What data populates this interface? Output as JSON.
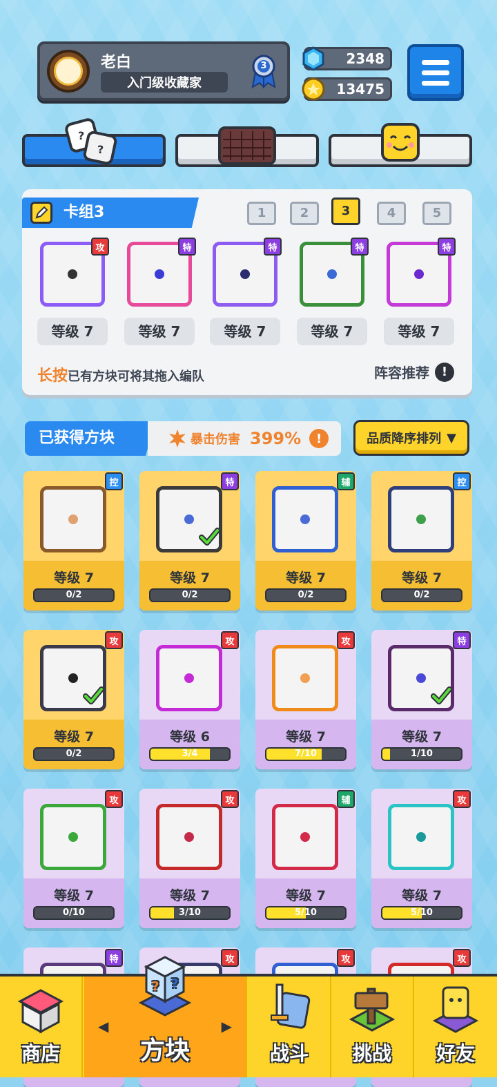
{
  "profile": {
    "name": "老白",
    "title": "入门级收藏家",
    "rank": "3"
  },
  "currency": {
    "gems": "2348",
    "coins": "13475"
  },
  "deck": {
    "title": "卡组3",
    "slots": [
      "1",
      "2",
      "3",
      "4",
      "5"
    ],
    "active_slot": "3",
    "cards": [
      {
        "tag": "攻",
        "tag_type": "atk",
        "level": "等级 7",
        "color": "#8b5cf6",
        "dot": "#333333"
      },
      {
        "tag": "特",
        "tag_type": "spe",
        "level": "等级 7",
        "color": "#e84a9a",
        "dot": "#3b3bd6"
      },
      {
        "tag": "特",
        "tag_type": "spe",
        "level": "等级 7",
        "color": "#8c5cf0",
        "dot": "#2c2c70"
      },
      {
        "tag": "特",
        "tag_type": "spe",
        "level": "等级 7",
        "color": "#3a8f3a",
        "dot": "#3b6ad6"
      },
      {
        "tag": "特",
        "tag_type": "spe",
        "level": "等级 7",
        "color": "#c43ad6",
        "dot": "#6a2ad0"
      }
    ],
    "hint_highlight": "长按",
    "hint_text": "已有方块可将其拖入编队",
    "recommend": "阵容推荐"
  },
  "owned": {
    "title": "已获得方块",
    "crit_label": "暴击伤害",
    "crit_value": "399%",
    "sort_label": "品质降序排列"
  },
  "cards": [
    {
      "tag": "控",
      "tag_type": "ctl",
      "level": "等级 7",
      "progress": "0/2",
      "fill": 0,
      "style": "gold",
      "color": "#8a5a2a",
      "dot": "#e0a070",
      "checked": false
    },
    {
      "tag": "特",
      "tag_type": "spe",
      "level": "等级 7",
      "progress": "0/2",
      "fill": 0,
      "style": "gold",
      "color": "#3a3a3a",
      "dot": "#4a6ad6",
      "checked": true
    },
    {
      "tag": "辅",
      "tag_type": "sup",
      "level": "等级 7",
      "progress": "0/2",
      "fill": 0,
      "style": "gold",
      "color": "#2f5fd0",
      "dot": "#4a6ad6",
      "checked": false
    },
    {
      "tag": "控",
      "tag_type": "ctl",
      "level": "等级 7",
      "progress": "0/2",
      "fill": 0,
      "style": "gold",
      "color": "#2f3f7a",
      "dot": "#3fa04a",
      "checked": false
    },
    {
      "tag": "攻",
      "tag_type": "atk",
      "level": "等级 7",
      "progress": "0/2",
      "fill": 0,
      "style": "gold",
      "color": "#3a3a4a",
      "dot": "#222222",
      "checked": true
    },
    {
      "tag": "攻",
      "tag_type": "atk",
      "level": "等级 6",
      "progress": "3/4",
      "fill": 0.75,
      "style": "purple",
      "color": "#c42ad6",
      "dot": "#c42ad6",
      "checked": false
    },
    {
      "tag": "攻",
      "tag_type": "atk",
      "level": "等级 7",
      "progress": "7/10",
      "fill": 0.7,
      "style": "purple",
      "color": "#f08a1a",
      "dot": "#f0a050",
      "checked": false
    },
    {
      "tag": "特",
      "tag_type": "spe",
      "level": "等级 7",
      "progress": "1/10",
      "fill": 0.1,
      "style": "purple",
      "color": "#5a2a6a",
      "dot": "#4a4ad6",
      "checked": true
    },
    {
      "tag": "攻",
      "tag_type": "atk",
      "level": "等级 7",
      "progress": "0/10",
      "fill": 0,
      "style": "purple",
      "color": "#3aa83a",
      "dot": "#3aa83a",
      "checked": false
    },
    {
      "tag": "攻",
      "tag_type": "atk",
      "level": "等级 7",
      "progress": "3/10",
      "fill": 0.3,
      "style": "purple",
      "color": "#c42a2a",
      "dot": "#c42a4a",
      "checked": false
    },
    {
      "tag": "辅",
      "tag_type": "sup",
      "level": "等级 7",
      "progress": "5/10",
      "fill": 0.5,
      "style": "purple",
      "color": "#d42a4a",
      "dot": "#d42a4a",
      "checked": false
    },
    {
      "tag": "攻",
      "tag_type": "atk",
      "level": "等级 7",
      "progress": "5/10",
      "fill": 0.5,
      "style": "purple",
      "color": "#2ac4c4",
      "dot": "#1a9a9a",
      "checked": false
    },
    {
      "tag": "特",
      "tag_type": "spe",
      "level": "",
      "progress": "",
      "fill": 0,
      "style": "purple",
      "color": "#5a3a7a",
      "dot": "#5a3a7a",
      "checked": false
    },
    {
      "tag": "攻",
      "tag_type": "atk",
      "level": "",
      "progress": "",
      "fill": 0,
      "style": "purple",
      "color": "#3a3a6a",
      "dot": "#3a3a6a",
      "checked": false
    },
    {
      "tag": "攻",
      "tag_type": "atk",
      "level": "",
      "progress": "",
      "fill": 0,
      "style": "purple",
      "color": "#2f5fd0",
      "dot": "#2f5fd0",
      "checked": false
    },
    {
      "tag": "攻",
      "tag_type": "atk",
      "level": "",
      "progress": "",
      "fill": 0,
      "style": "purple",
      "color": "#d42a2a",
      "dot": "#d42a2a",
      "checked": false
    }
  ],
  "nav": {
    "shop": "商店",
    "blocks": "方块",
    "battle": "战斗",
    "challenge": "挑战",
    "friends": "好友"
  }
}
